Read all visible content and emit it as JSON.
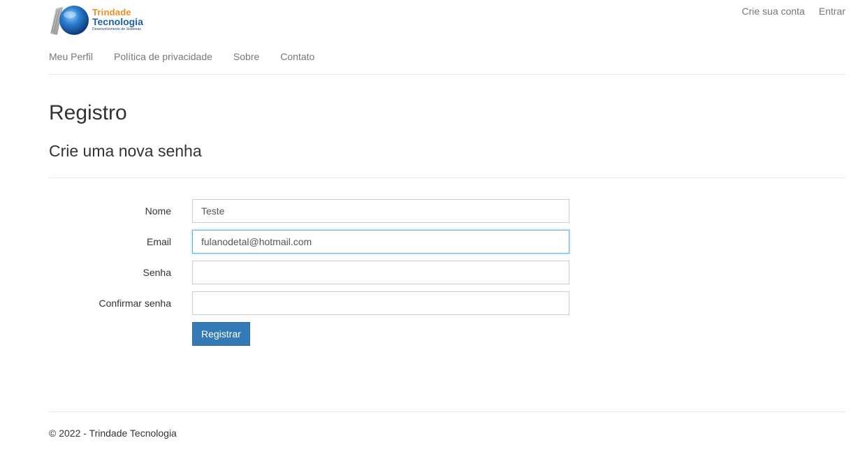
{
  "brand": {
    "name_line1": "Trindade",
    "name_line2": "Tecnologia",
    "tagline": "Desenvolvimento de Sistemas",
    "colors": {
      "orange": "#f28c1f",
      "blue": "#1f5fa8"
    }
  },
  "top_nav": {
    "register_label": "Crie sua conta",
    "login_label": "Entrar"
  },
  "main_nav": {
    "items": [
      {
        "label": "Meu Perfil"
      },
      {
        "label": "Política de privacidade"
      },
      {
        "label": "Sobre"
      },
      {
        "label": "Contato"
      }
    ]
  },
  "page": {
    "title": "Registro",
    "subtitle": "Crie uma nova senha"
  },
  "form": {
    "name": {
      "label": "Nome",
      "value": "Teste"
    },
    "email": {
      "label": "Email",
      "value": "fulanodetal@hotmail.com"
    },
    "password": {
      "label": "Senha",
      "value": ""
    },
    "confirm_password": {
      "label": "Confirmar senha",
      "value": ""
    },
    "submit_label": "Registrar",
    "accent_color": "#337ab7"
  },
  "footer": {
    "text": "© 2022 - Trindade Tecnologia"
  }
}
